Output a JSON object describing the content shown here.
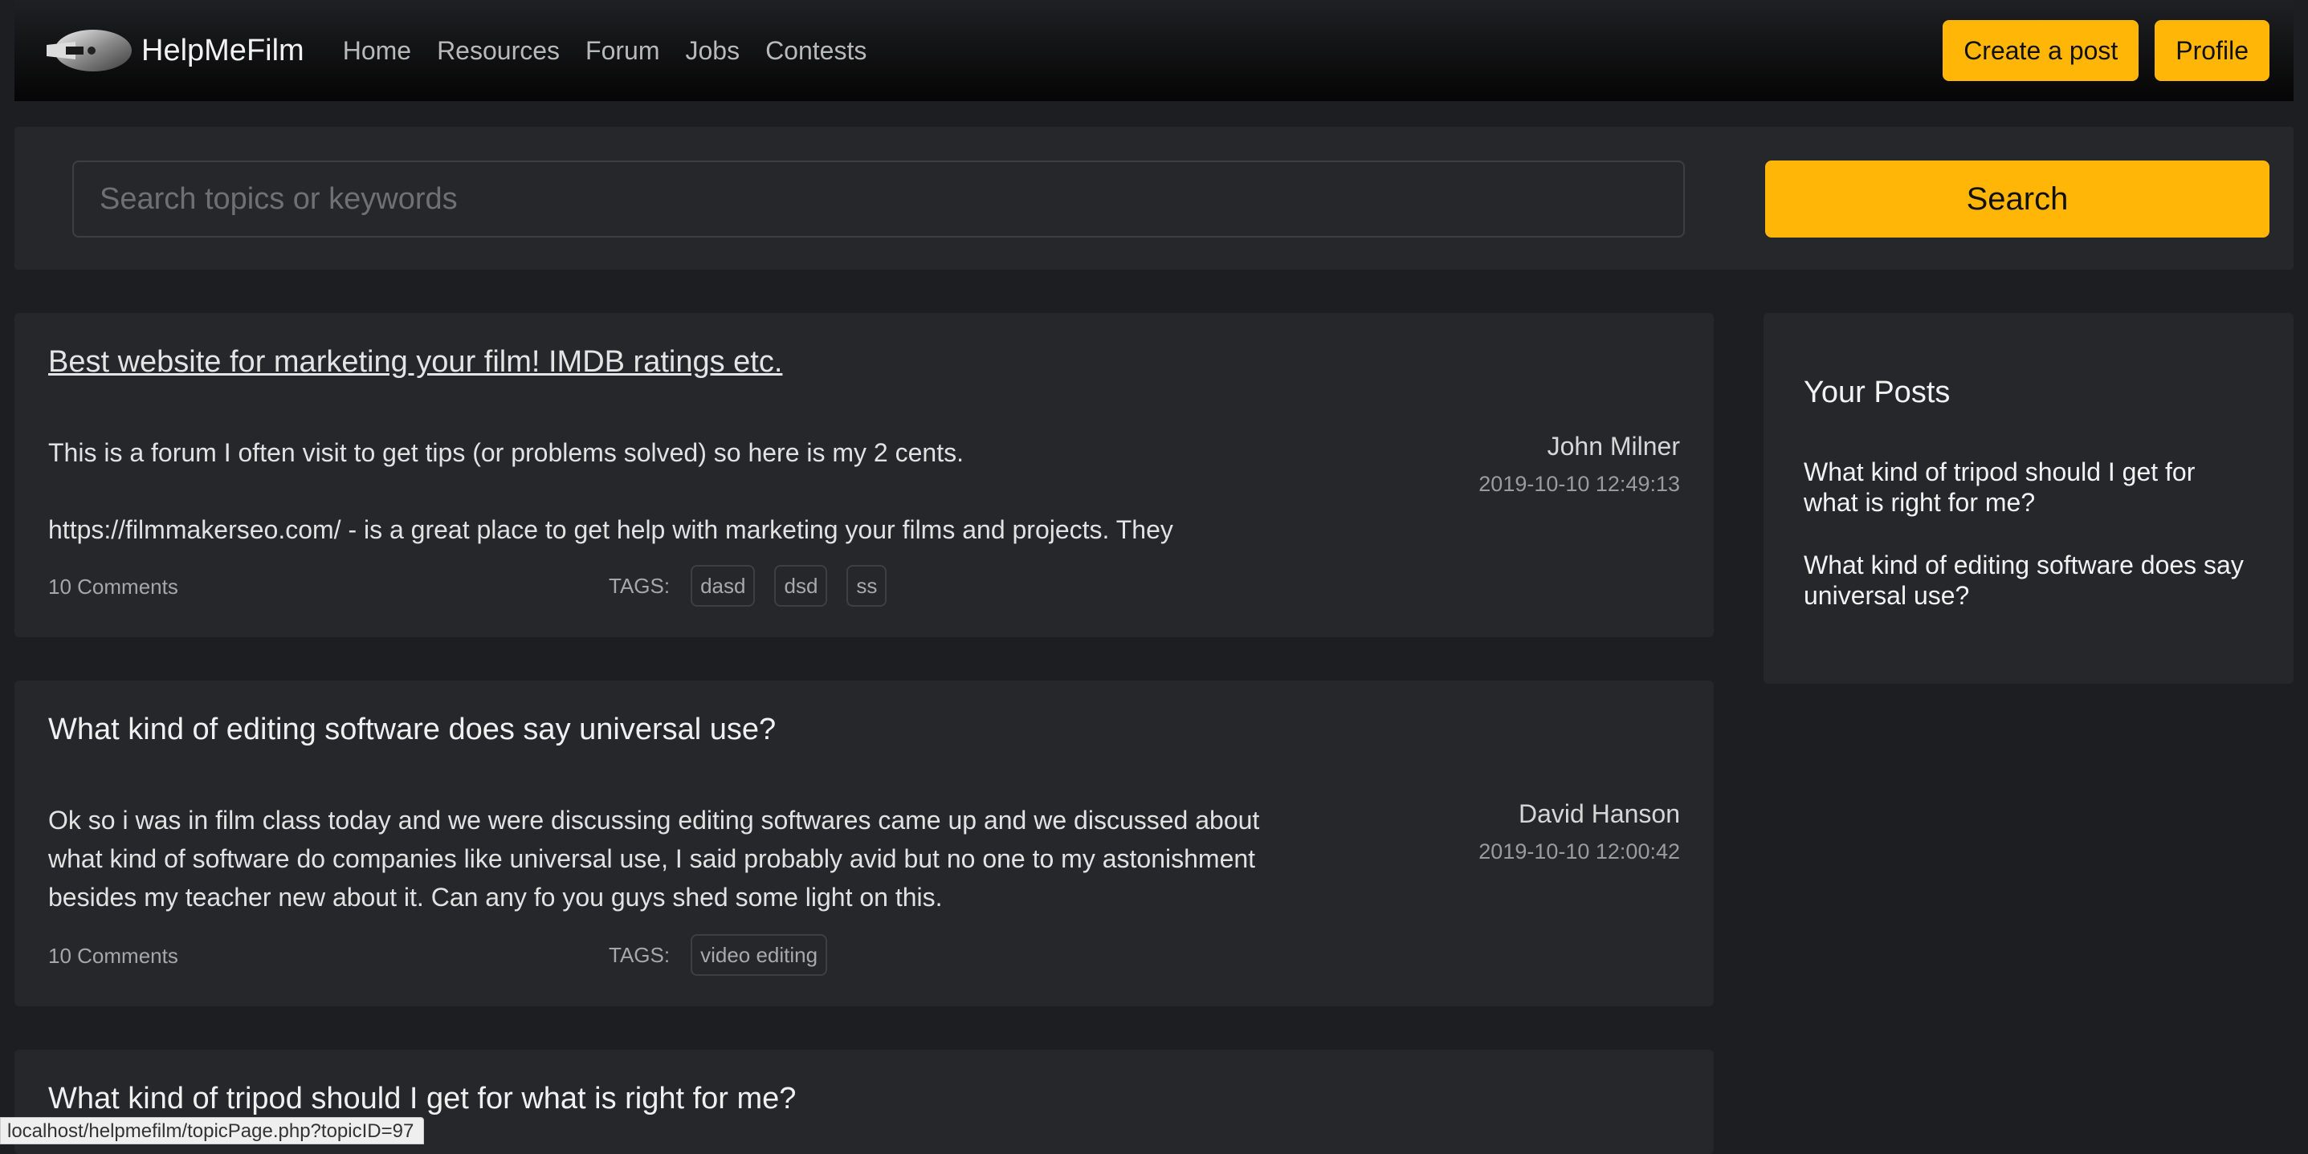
{
  "app": {
    "brand_name": "HelpMeFilm",
    "logo_icon": "camera-lens-logo"
  },
  "nav": {
    "links": [
      "Home",
      "Resources",
      "Forum",
      "Jobs",
      "Contests"
    ],
    "create_post_label": "Create a post",
    "profile_label": "Profile"
  },
  "search": {
    "placeholder": "Search topics or keywords",
    "value": "",
    "button_label": "Search"
  },
  "posts": [
    {
      "title": "Best website for marketing your film! IMDB ratings etc.",
      "title_hovered": true,
      "author": "John Milner",
      "date": "2019-10-10 12:49:13",
      "body": [
        "This is a forum I often visit to get tips (or problems solved) so here is my 2 cents.",
        "https://filmmakerseo.com/ - is a great place to get help with marketing your films and projects. They"
      ],
      "comments": "10 Comments",
      "tags_label": "TAGS:",
      "tags": [
        "dasd",
        "dsd",
        "ss"
      ]
    },
    {
      "title": "What kind of editing software does say universal use?",
      "title_hovered": false,
      "author": "David Hanson",
      "date": "2019-10-10 12:00:42",
      "body": [
        "Ok so i was in film class today and we were discussing editing softwares came up and we discussed about what kind of software do companies like universal use, I said probably avid but no one to my astonishment besides my teacher new about it. Can any fo you guys shed some light on this."
      ],
      "comments": "10 Comments",
      "tags_label": "TAGS:",
      "tags": [
        "video editing"
      ]
    },
    {
      "title": "What kind of tripod should I get for what is right for me?",
      "title_hovered": false
    }
  ],
  "sidebar": {
    "title": "Your Posts",
    "links": [
      "What kind of tripod should I get for what is right for me?",
      "What kind of editing software does say universal use?"
    ]
  },
  "status_url": "localhost/helpmefilm/topicPage.php?topicID=97",
  "colors": {
    "accent": "#ffb607",
    "background": "#1d1e21",
    "card": "#26272b"
  }
}
